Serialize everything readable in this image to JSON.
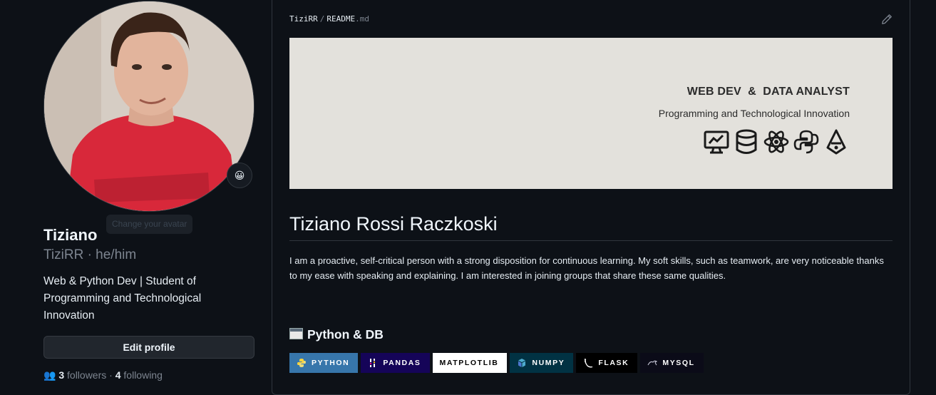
{
  "profile": {
    "name": "Tiziano",
    "login_pronouns": "TiziRR · he/him",
    "bio": "Web & Python Dev | Student of Programming and Technological Innovation",
    "edit_button": "Edit profile",
    "avatar_tooltip": "Change your avatar",
    "status_emoji": "😀",
    "followers_count": "3",
    "followers_label": "followers",
    "following_count": "4",
    "following_label": "following"
  },
  "readme": {
    "owner": "TiziRR",
    "separator": "/",
    "file_name": "README",
    "file_ext": ".md",
    "banner_title": "WEB DEV  &  DATA ANALYST",
    "banner_subtitle": "Programming and Technological Innovation",
    "banner_icons": [
      "monitor-chart-icon",
      "database-icon",
      "react-atom-icon",
      "python-icon",
      "pen-nib-icon"
    ],
    "heading": "Tiziano Rossi Raczkoski",
    "paragraph": "I am a proactive, self-critical person with a strong disposition for continuous learning. My soft skills, such as teamwork, are very noticeable thanks to my ease with speaking and explaining. I am interested in joining groups that share these same qualities.",
    "section_title": "Python & DB",
    "badges": [
      {
        "label": "PYTHON",
        "bg": "#3776ab",
        "fg": "#ffffff"
      },
      {
        "label": "PANDAS",
        "bg": "#150458",
        "fg": "#ffffff"
      },
      {
        "label": "MATPLOTLIB",
        "bg": "#ffffff",
        "fg": "#000000"
      },
      {
        "label": "NUMPY",
        "bg": "#013243",
        "fg": "#ffffff"
      },
      {
        "label": "FLASK",
        "bg": "#000000",
        "fg": "#ffffff"
      },
      {
        "label": "MYSQL",
        "bg": "#00000f",
        "fg": "#ffffff"
      }
    ]
  },
  "colors": {
    "background": "#0d1117",
    "border": "#30363d",
    "muted_text": "#7d8590",
    "banner_bg": "#e3e1dc"
  }
}
